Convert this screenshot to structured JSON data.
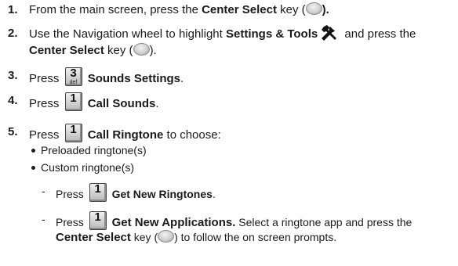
{
  "steps": [
    {
      "num": "1.",
      "a": "From the main screen, press the ",
      "b": "Center Select",
      "c": " key (",
      "d": ")."
    },
    {
      "num": "2.",
      "a": "Use the Navigation wheel to highlight ",
      "b": "Settings & Tools",
      "c": " and press the",
      "d": "Center Select",
      "e": " key (",
      "f": ")."
    },
    {
      "num": "3.",
      "a": "Press",
      "key": "3",
      "key_sub": "def",
      "b": "Sounds Settings",
      "c": "."
    },
    {
      "num": "4.",
      "a": "Press",
      "key": "1",
      "b": "Call Sounds",
      "c": "."
    },
    {
      "num": "5.",
      "a": "Press",
      "key": "1",
      "b": "Call Ringtone",
      "c": " to choose:"
    }
  ],
  "bullets": [
    "Preloaded ringtone(s)",
    "Custom ringtone(s)"
  ],
  "subs": [
    {
      "dash": "-",
      "a": "Press",
      "key": "1",
      "b": "Get New Ringtones",
      "c": "."
    },
    {
      "dash": "-",
      "a": "Press",
      "key": "1",
      "b": "Get New Applications.",
      "c": " Select a ringtone app and press the",
      "d": "Center Select",
      "e": " key (",
      "f": ") to follow the on screen prompts."
    }
  ],
  "icons": {
    "center_key": "center-select-key-icon",
    "tools": "settings-tools-icon",
    "key_1": "keypad-1-key-icon",
    "key_3": "keypad-3-key-icon"
  }
}
